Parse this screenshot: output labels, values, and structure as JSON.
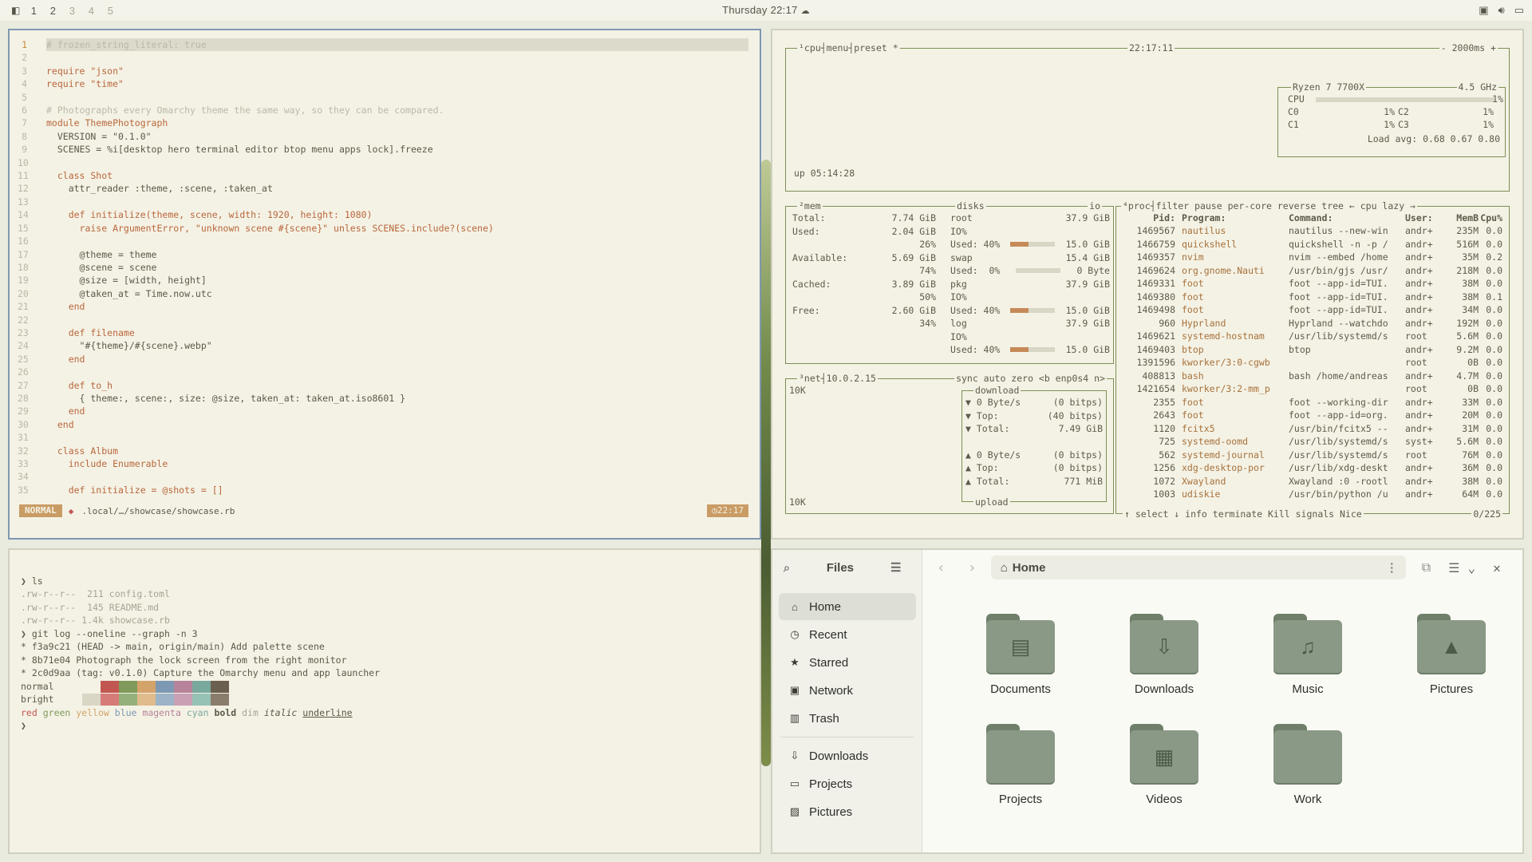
{
  "topbar": {
    "workspaces": [
      "1",
      "2",
      "3",
      "4",
      "5"
    ],
    "clock": "Thursday 22:17"
  },
  "editor": {
    "lines": [
      {
        "n": "1",
        "t": "# frozen_string_literal: true"
      },
      {
        "n": "2",
        "t": ""
      },
      {
        "n": "3",
        "t": "require \"json\""
      },
      {
        "n": "4",
        "t": "require \"time\""
      },
      {
        "n": "5",
        "t": ""
      },
      {
        "n": "6",
        "t": "# Photographs every Omarchy theme the same way, so they can be compared."
      },
      {
        "n": "7",
        "t": "module ThemePhotograph"
      },
      {
        "n": "8",
        "t": "  VERSION = \"0.1.0\""
      },
      {
        "n": "9",
        "t": "  SCENES = %i[desktop hero terminal editor btop menu apps lock].freeze"
      },
      {
        "n": "10",
        "t": ""
      },
      {
        "n": "11",
        "t": "  class Shot"
      },
      {
        "n": "12",
        "t": "    attr_reader :theme, :scene, :taken_at"
      },
      {
        "n": "13",
        "t": ""
      },
      {
        "n": "14",
        "t": "    def initialize(theme, scene, width: 1920, height: 1080)"
      },
      {
        "n": "15",
        "t": "      raise ArgumentError, \"unknown scene #{scene}\" unless SCENES.include?(scene)"
      },
      {
        "n": "16",
        "t": ""
      },
      {
        "n": "17",
        "t": "      @theme = theme"
      },
      {
        "n": "18",
        "t": "      @scene = scene"
      },
      {
        "n": "19",
        "t": "      @size = [width, height]"
      },
      {
        "n": "20",
        "t": "      @taken_at = Time.now.utc"
      },
      {
        "n": "21",
        "t": "    end"
      },
      {
        "n": "22",
        "t": ""
      },
      {
        "n": "23",
        "t": "    def filename"
      },
      {
        "n": "24",
        "t": "      \"#{theme}/#{scene}.webp\""
      },
      {
        "n": "25",
        "t": "    end"
      },
      {
        "n": "26",
        "t": ""
      },
      {
        "n": "27",
        "t": "    def to_h"
      },
      {
        "n": "28",
        "t": "      { theme:, scene:, size: @size, taken_at: taken_at.iso8601 }"
      },
      {
        "n": "29",
        "t": "    end"
      },
      {
        "n": "30",
        "t": "  end"
      },
      {
        "n": "31",
        "t": ""
      },
      {
        "n": "32",
        "t": "  class Album"
      },
      {
        "n": "33",
        "t": "    include Enumerable"
      },
      {
        "n": "34",
        "t": ""
      },
      {
        "n": "35",
        "t": "    def initialize = @shots = []"
      }
    ],
    "mode": "NORMAL",
    "path": ".local/…/showcase/showcase.rb",
    "time": "22:17"
  },
  "terminal": {
    "lines": [
      "❯ ls",
      ".rw-r--r--  211 config.toml",
      ".rw-r--r--  145 README.md",
      ".rw-r--r-- 1.4k showcase.rb",
      "❯ git log --oneline --graph -n 3",
      "* f3a9c21 (HEAD -> main, origin/main) Add palette scene",
      "* 8b71e04 Photograph the lock screen from the right monitor",
      "* 2c0d9aa (tag: v0.1.0) Capture the Omarchy menu and app launcher"
    ],
    "palette_labels": [
      "normal",
      "bright"
    ],
    "normal_colors": [
      "#f4f2e5",
      "#c25752",
      "#7f9a5a",
      "#d4a36a",
      "#7d98b3",
      "#b7839a",
      "#79a89d",
      "#6b5f4f"
    ],
    "bright_colors": [
      "#d9d6c6",
      "#d67b77",
      "#96b07a",
      "#e0bb8c",
      "#9cb3c8",
      "#c9a0b4",
      "#96c2b6",
      "#8a7d6c"
    ],
    "style_words": [
      "red",
      "green",
      "yellow",
      "blue",
      "magenta",
      "cyan",
      "bold",
      "dim",
      "italic",
      "underline"
    ],
    "prompt": "❯"
  },
  "btop": {
    "cpu": {
      "label": "¹cpu",
      "menu": "menu",
      "preset": "preset *",
      "time": "22:17:11",
      "interval": "- 2000ms +",
      "model": "Ryzen 7 7700X",
      "freq": "4.5 GHz",
      "rows": [
        {
          "name": "CPU",
          "pct": "1%"
        },
        {
          "name": "C0",
          "pct": "1%"
        },
        {
          "name": "C1",
          "pct": "1%"
        },
        {
          "name": "C2",
          "pct": "1%"
        },
        {
          "name": "C3",
          "pct": "1%"
        }
      ],
      "loadavg": "Load avg: 0.68 0.67 0.80",
      "uptime": "up 05:14:28"
    },
    "mem": {
      "label": "²mem",
      "rows": [
        {
          "k": "Total:",
          "v": "7.74 GiB"
        },
        {
          "k": "Used:",
          "v": "2.04 GiB"
        },
        {
          "k": "",
          "v": "26%"
        },
        {
          "k": "Available:",
          "v": "5.69 GiB"
        },
        {
          "k": "",
          "v": "74%"
        },
        {
          "k": "Cached:",
          "v": "3.89 GiB"
        },
        {
          "k": "",
          "v": "50%"
        },
        {
          "k": "Free:",
          "v": "2.60 GiB"
        },
        {
          "k": "",
          "v": "34%"
        }
      ]
    },
    "disks": {
      "label": "disks",
      "io": "io",
      "rows": [
        {
          "k": "root",
          "v": "37.9 GiB"
        },
        {
          "k": "IO%",
          "v": ""
        },
        {
          "k": "Used: 40%",
          "v": "15.0 GiB",
          "fill": 0.4
        },
        {
          "k": "swap",
          "v": "15.4 GiB"
        },
        {
          "k": "Used:  0%",
          "v": "0 Byte",
          "fill": 0
        },
        {
          "k": "pkg",
          "v": "37.9 GiB"
        },
        {
          "k": "IO%",
          "v": ""
        },
        {
          "k": "Used: 40%",
          "v": "15.0 GiB",
          "fill": 0.4
        },
        {
          "k": "log",
          "v": "37.9 GiB"
        },
        {
          "k": "IO%",
          "v": ""
        },
        {
          "k": "Used: 40%",
          "v": "15.0 GiB",
          "fill": 0.4
        }
      ]
    },
    "net": {
      "label": "³net",
      "ip": "10.0.2.15",
      "opts": "sync auto zero <b enp0s4 n>",
      "scale_top": "10K",
      "scale_bottom": "10K",
      "download": "download",
      "upload": "upload",
      "rows": [
        {
          "k": "▼ 0 Byte/s",
          "v": "(0 bitps)"
        },
        {
          "k": "▼ Top:",
          "v": "(40 bitps)"
        },
        {
          "k": "▼ Total:",
          "v": "7.49 GiB"
        },
        {
          "k": "▲ 0 Byte/s",
          "v": "(0 bitps)"
        },
        {
          "k": "▲ Top:",
          "v": "(0 bitps)"
        },
        {
          "k": "▲ Total:",
          "v": "771 MiB"
        }
      ]
    },
    "proc": {
      "label": "⁴proc",
      "opts": "filter     pause per-core reverse tree ← cpu lazy →",
      "headers": [
        "Pid:",
        "Program:",
        "Command:",
        "User:",
        "MemB",
        "Cpu%"
      ],
      "rows": [
        [
          "1469567",
          "nautilus",
          "nautilus --new-win",
          "andr+",
          "235M",
          "0.0"
        ],
        [
          "1466759",
          "quickshell",
          "quickshell -n -p /",
          "andr+",
          "516M",
          "0.0"
        ],
        [
          "1469357",
          "nvim",
          "nvim --embed /home",
          "andr+",
          "35M",
          "0.2"
        ],
        [
          "1469624",
          "org.gnome.Nauti",
          "/usr/bin/gjs /usr/",
          "andr+",
          "218M",
          "0.0"
        ],
        [
          "1469331",
          "foot",
          "foot --app-id=TUI.",
          "andr+",
          "38M",
          "0.0"
        ],
        [
          "1469380",
          "foot",
          "foot --app-id=TUI.",
          "andr+",
          "38M",
          "0.1"
        ],
        [
          "1469498",
          "foot",
          "foot --app-id=TUI.",
          "andr+",
          "34M",
          "0.0"
        ],
        [
          "960",
          "Hyprland",
          "Hyprland --watchdo",
          "andr+",
          "192M",
          "0.0"
        ],
        [
          "1469621",
          "systemd-hostnam",
          "/usr/lib/systemd/s",
          "root",
          "5.6M",
          "0.0"
        ],
        [
          "1469403",
          "btop",
          "btop",
          "andr+",
          "9.2M",
          "0.0"
        ],
        [
          "1391596",
          "kworker/3:0-cgwb",
          "",
          "root",
          "0B",
          "0.0"
        ],
        [
          "408813",
          "bash",
          "bash /home/andreas",
          "andr+",
          "4.7M",
          "0.0"
        ],
        [
          "1421654",
          "kworker/3:2-mm_p",
          "",
          "root",
          "0B",
          "0.0"
        ],
        [
          "2355",
          "foot",
          "foot --working-dir",
          "andr+",
          "33M",
          "0.0"
        ],
        [
          "2643",
          "foot",
          "foot --app-id=org.",
          "andr+",
          "20M",
          "0.0"
        ],
        [
          "1120",
          "fcitx5",
          "/usr/bin/fcitx5 --",
          "andr+",
          "31M",
          "0.0"
        ],
        [
          "725",
          "systemd-oomd",
          "/usr/lib/systemd/s",
          "syst+",
          "5.6M",
          "0.0"
        ],
        [
          "562",
          "systemd-journal",
          "/usr/lib/systemd/s",
          "root",
          "76M",
          "0.0"
        ],
        [
          "1256",
          "xdg-desktop-por",
          "/usr/lib/xdg-deskt",
          "andr+",
          "36M",
          "0.0"
        ],
        [
          "1072",
          "Xwayland",
          "Xwayland :0 -rootl",
          "andr+",
          "38M",
          "0.0"
        ],
        [
          "1003",
          "udiskie",
          "/usr/bin/python /u",
          "andr+",
          "64M",
          "0.0"
        ]
      ],
      "footer": "↑ select ↓ info  terminate Kill signals Nice",
      "count": "0/225"
    }
  },
  "files": {
    "title": "Files",
    "location": "Home",
    "sidebar": [
      {
        "label": "Home",
        "icon": "home-icon"
      },
      {
        "label": "Recent",
        "icon": "clock-icon"
      },
      {
        "label": "Starred",
        "icon": "star-icon"
      },
      {
        "label": "Network",
        "icon": "network-icon"
      },
      {
        "label": "Trash",
        "icon": "trash-icon"
      },
      {
        "label": "Downloads",
        "icon": "download-icon"
      },
      {
        "label": "Projects",
        "icon": "folder-icon"
      },
      {
        "label": "Pictures",
        "icon": "image-icon"
      }
    ],
    "folders": [
      {
        "label": "Documents",
        "glyph": "▤"
      },
      {
        "label": "Downloads",
        "glyph": "⇩"
      },
      {
        "label": "Music",
        "glyph": "♫"
      },
      {
        "label": "Pictures",
        "glyph": "▲"
      },
      {
        "label": "Projects",
        "glyph": ""
      },
      {
        "label": "Videos",
        "glyph": "▦"
      },
      {
        "label": "Work",
        "glyph": ""
      }
    ]
  }
}
